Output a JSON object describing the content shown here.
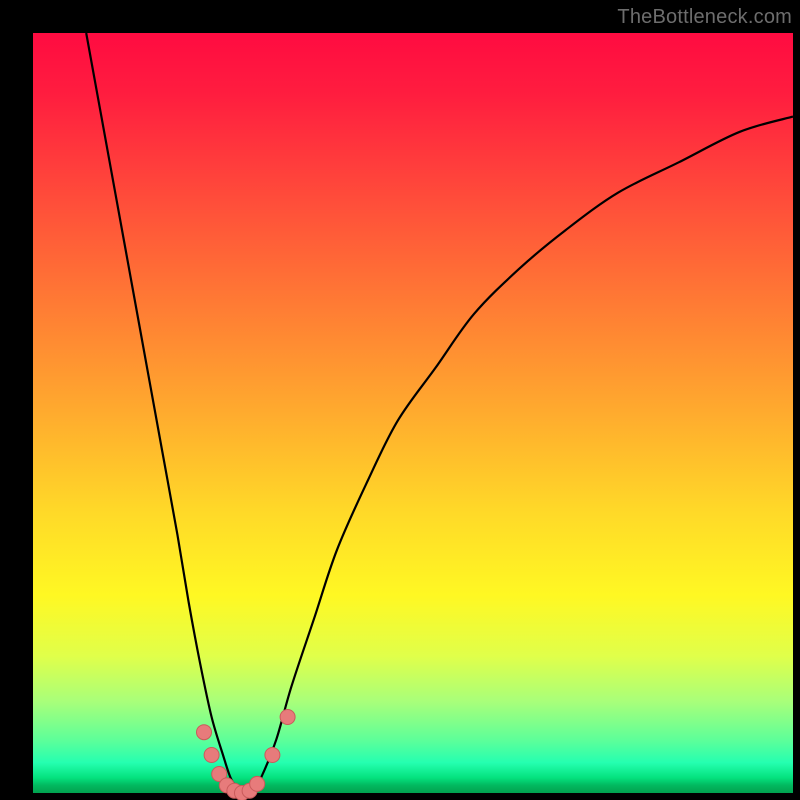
{
  "watermark": "TheBottleneck.com",
  "colors": {
    "frame": "#000000",
    "curve": "#000000",
    "dot_fill": "#e77b7b",
    "dot_stroke": "#c95b5b",
    "gradient_top": "#ff0b41",
    "gradient_bottom": "#01a24f"
  },
  "chart_data": {
    "type": "line",
    "title": "",
    "xlabel": "",
    "ylabel": "",
    "xlim": [
      0,
      100
    ],
    "ylim": [
      0,
      100
    ],
    "grid": false,
    "legend": false,
    "series": [
      {
        "name": "curve",
        "x": [
          7,
          9,
          11,
          13,
          15,
          17,
          19,
          20.5,
          22,
          23.5,
          25,
          26,
          27,
          28,
          29,
          30,
          32,
          34,
          37,
          40,
          44,
          48,
          53,
          58,
          64,
          70,
          77,
          85,
          93,
          100
        ],
        "y": [
          100,
          89,
          78,
          67,
          56,
          45,
          34,
          25,
          17,
          10,
          5,
          2,
          0.5,
          0,
          0.5,
          2,
          7,
          14,
          23,
          32,
          41,
          49,
          56,
          63,
          69,
          74,
          79,
          83,
          87,
          89
        ]
      }
    ],
    "markers": [
      {
        "x": 22.5,
        "y": 8
      },
      {
        "x": 23.5,
        "y": 5
      },
      {
        "x": 24.5,
        "y": 2.5
      },
      {
        "x": 25.5,
        "y": 1
      },
      {
        "x": 26.5,
        "y": 0.3
      },
      {
        "x": 27.5,
        "y": 0
      },
      {
        "x": 28.5,
        "y": 0.3
      },
      {
        "x": 29.5,
        "y": 1.2
      },
      {
        "x": 31.5,
        "y": 5
      },
      {
        "x": 33.5,
        "y": 10
      }
    ]
  }
}
